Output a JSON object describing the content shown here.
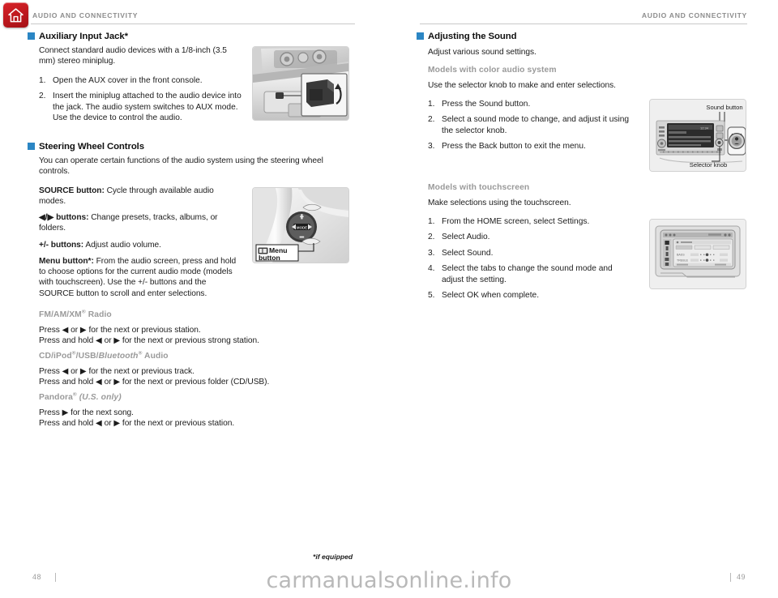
{
  "document": {
    "watermark": "carmanualsonline.info"
  },
  "left_page": {
    "running_head": "AUDIO AND CONNECTIVITY",
    "page_number": "48",
    "footnote": "*if equipped",
    "sections": [
      {
        "title": "Auxiliary Input Jack*",
        "intro": "Connect standard audio devices with a 1/8-inch (3.5 mm) stereo miniplug.",
        "steps": [
          {
            "num": "1.",
            "text": "Open the AUX cover in the front console."
          },
          {
            "num": "2.",
            "text": "Insert the miniplug attached to the audio device into the jack. The audio system switches to AUX mode. Use the device to control the audio."
          }
        ],
        "figure_caption": ""
      },
      {
        "title": "Steering Wheel Controls",
        "intro": "You can operate certain functions of the audio system using the steering wheel controls.",
        "items": [
          {
            "label": "SOURCE button:",
            "text": " Cycle through available audio modes."
          },
          {
            "label": "◀/▶ buttons:",
            "text": " Change presets, tracks, albums, or folders."
          },
          {
            "label": "+/- buttons:",
            "text": " Adjust audio volume."
          },
          {
            "label": "Menu button*:",
            "text": " From the audio screen, press and hold to choose options for the current audio mode (models with touchscreen). Use the +/- buttons and the SOURCE button to scroll and enter selections."
          }
        ],
        "figure_labels": {
          "menu_button_line1": "Menu",
          "menu_button_line2": "button"
        }
      }
    ],
    "radio_groups": [
      {
        "heading": "FM/AM/XM® Radio",
        "lines": [
          "Press ◀ or ▶ for the next or previous station.",
          "Press and hold ◀ or ▶ for the next or previous strong station."
        ]
      },
      {
        "heading": "CD/iPod®/USB/Bluetooth® Audio",
        "heading_parts": {
          "pre": "CD/iPod®/USB/",
          "italic": "Bluetooth",
          "post": "® Audio"
        },
        "lines": [
          "Press ◀ or ▶ for the next or previous track.",
          "Press and hold ◀ or ▶ for the next or previous folder (CD/USB)."
        ]
      },
      {
        "heading": "Pandora® (U.S. only)",
        "heading_parts": {
          "pre": "Pandora® ",
          "italic": "(U.S. only)",
          "post": ""
        },
        "lines": [
          "Press ▶ for the next song.",
          "Press and hold ◀ or ▶ for the next or previous station."
        ]
      }
    ]
  },
  "right_page": {
    "running_head": "AUDIO AND CONNECTIVITY",
    "page_number": "49",
    "section": {
      "title": "Adjusting the Sound",
      "intro": "Adjust various sound settings."
    },
    "groups": [
      {
        "subhead": "Models with color audio system",
        "lead": "Use the selector knob to make and enter selections.",
        "steps": [
          {
            "num": "1.",
            "text": "Press the Sound button."
          },
          {
            "num": "2.",
            "text": "Select a sound mode to change, and adjust it using the selector knob."
          },
          {
            "num": "3.",
            "text": "Press the Back button to exit the menu."
          }
        ],
        "figure_labels": {
          "top": "Sound button",
          "bottom": "Selector knob"
        }
      },
      {
        "subhead": "Models with touchscreen",
        "lead": "Make selections using the touchscreen.",
        "steps": [
          {
            "num": "1.",
            "text": "From the HOME screen, select Settings."
          },
          {
            "num": "2.",
            "text": "Select Audio."
          },
          {
            "num": "3.",
            "text": "Select Sound."
          },
          {
            "num": "4.",
            "text": "Select the tabs to change the sound mode and adjust the setting."
          },
          {
            "num": "5.",
            "text": "Select OK when complete."
          }
        ],
        "figure_labels": {}
      }
    ]
  },
  "colors": {
    "bullet": "#2b86c4",
    "subhead": "#9a9a9a",
    "runhead": "#8d8d8d",
    "home_icon": "#c21a20"
  }
}
